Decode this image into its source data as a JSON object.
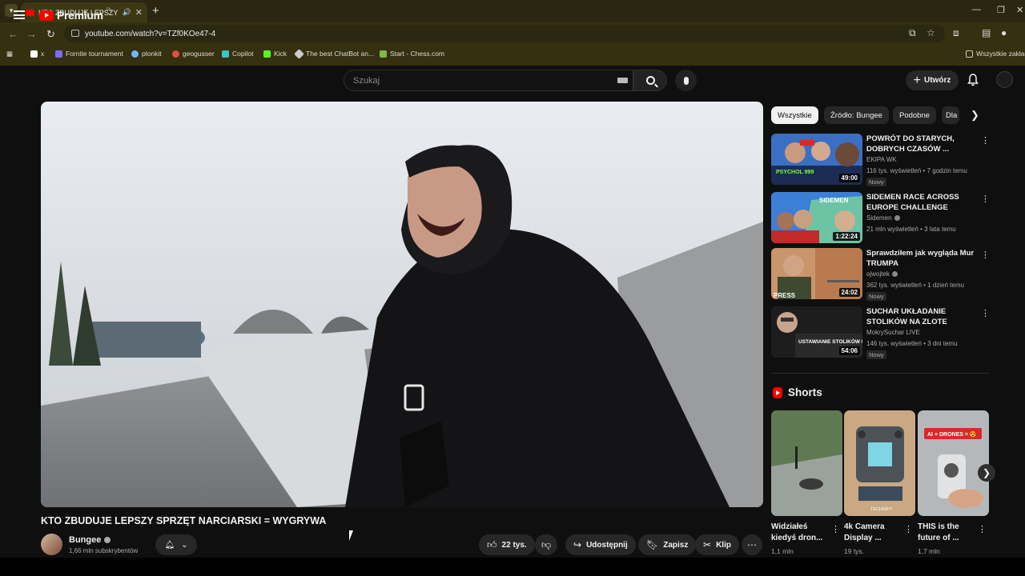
{
  "browser": {
    "tab_title": "KTO ZBUDUJE LEPSZY SPRZ",
    "url": "youtube.com/watch?v=TZf0KOe47-4",
    "bookmarks": [
      {
        "label": "x",
        "color": "#ffffff"
      },
      {
        "label": "Fornite tournament",
        "color": "#7b6cff"
      },
      {
        "label": "plonkit",
        "color": "#6fb7ff"
      },
      {
        "label": "geogusser",
        "color": "#e74c3c"
      },
      {
        "label": "Copilot",
        "color": "#38c6c6"
      },
      {
        "label": "Kick",
        "color": "#53fc18"
      },
      {
        "label": "The best ChatBot an...",
        "color": "#cccccc"
      },
      {
        "label": "Start - Chess.com",
        "color": "#81b64c"
      }
    ],
    "other_bookmarks": "Wszystkie zakład"
  },
  "header": {
    "logo": "Premium",
    "logo_country": "PL",
    "search_placeholder": "Szukaj",
    "create_label": "Utwórz"
  },
  "video": {
    "title": "KTO ZBUDUJE LEPSZY SPRZĘT NARCIARSKI = WYGRYWA",
    "channel": "Bungee",
    "subscribers": "1,66 mln subskrybentów",
    "likes": "22 tys.",
    "share_label": "Udostępnij",
    "save_label": "Zapisz",
    "clip_label": "Klip"
  },
  "chips": [
    "Wszystkie",
    "Źródło: Bungee",
    "Podobne",
    "Dla"
  ],
  "recommendations": [
    {
      "title": "POWRÓT DO STARYCH, DOBRYCH CZASÓW ...",
      "channel": "EKIPA WK",
      "meta": "116 tys. wyświetleń • 7 godzin temu",
      "badge": "Nowy",
      "duration": "49:00",
      "thumb_text": "PSYCHOL 999"
    },
    {
      "title": "SIDEMEN RACE ACROSS EUROPE CHALLENGE",
      "channel": "Sidemen",
      "meta": "21 mln wyświetleń • 3 lata temu",
      "badge": "",
      "duration": "1:22:24",
      "thumb_text": "SIDEMEN"
    },
    {
      "title": "Sprawdziłem jak wygląda Mur TRUMPA",
      "channel": "ojwojtek",
      "meta": "362 tys. wyświetleń • 1 dzień temu",
      "badge": "Nowy",
      "duration": "24:02",
      "thumb_text": "PRESS"
    },
    {
      "title": "SUCHAR UKŁADANIE STOLIKÓW NA ZLOTE ANTOSI...",
      "channel": "MokrySuchar LIVE",
      "meta": "146 tys. wyświetleń • 3 dni temu",
      "badge": "Nowy",
      "duration": "54:06",
      "thumb_text": "USTAWIANIE STOLIKÓW NA ZLOTE AN"
    }
  ],
  "shorts": {
    "heading": "Shorts",
    "items": [
      {
        "title": "Widziałeś kiedyś dron...",
        "views": "1,1 mln"
      },
      {
        "title": "4k Camera Display ...",
        "views": "19 tys.",
        "thumb_text": "TECHSIFY"
      },
      {
        "title": "THIS is the future of ...",
        "views": "1,7 mln",
        "thumb_text": "AI + DRONES = 😍"
      }
    ]
  }
}
